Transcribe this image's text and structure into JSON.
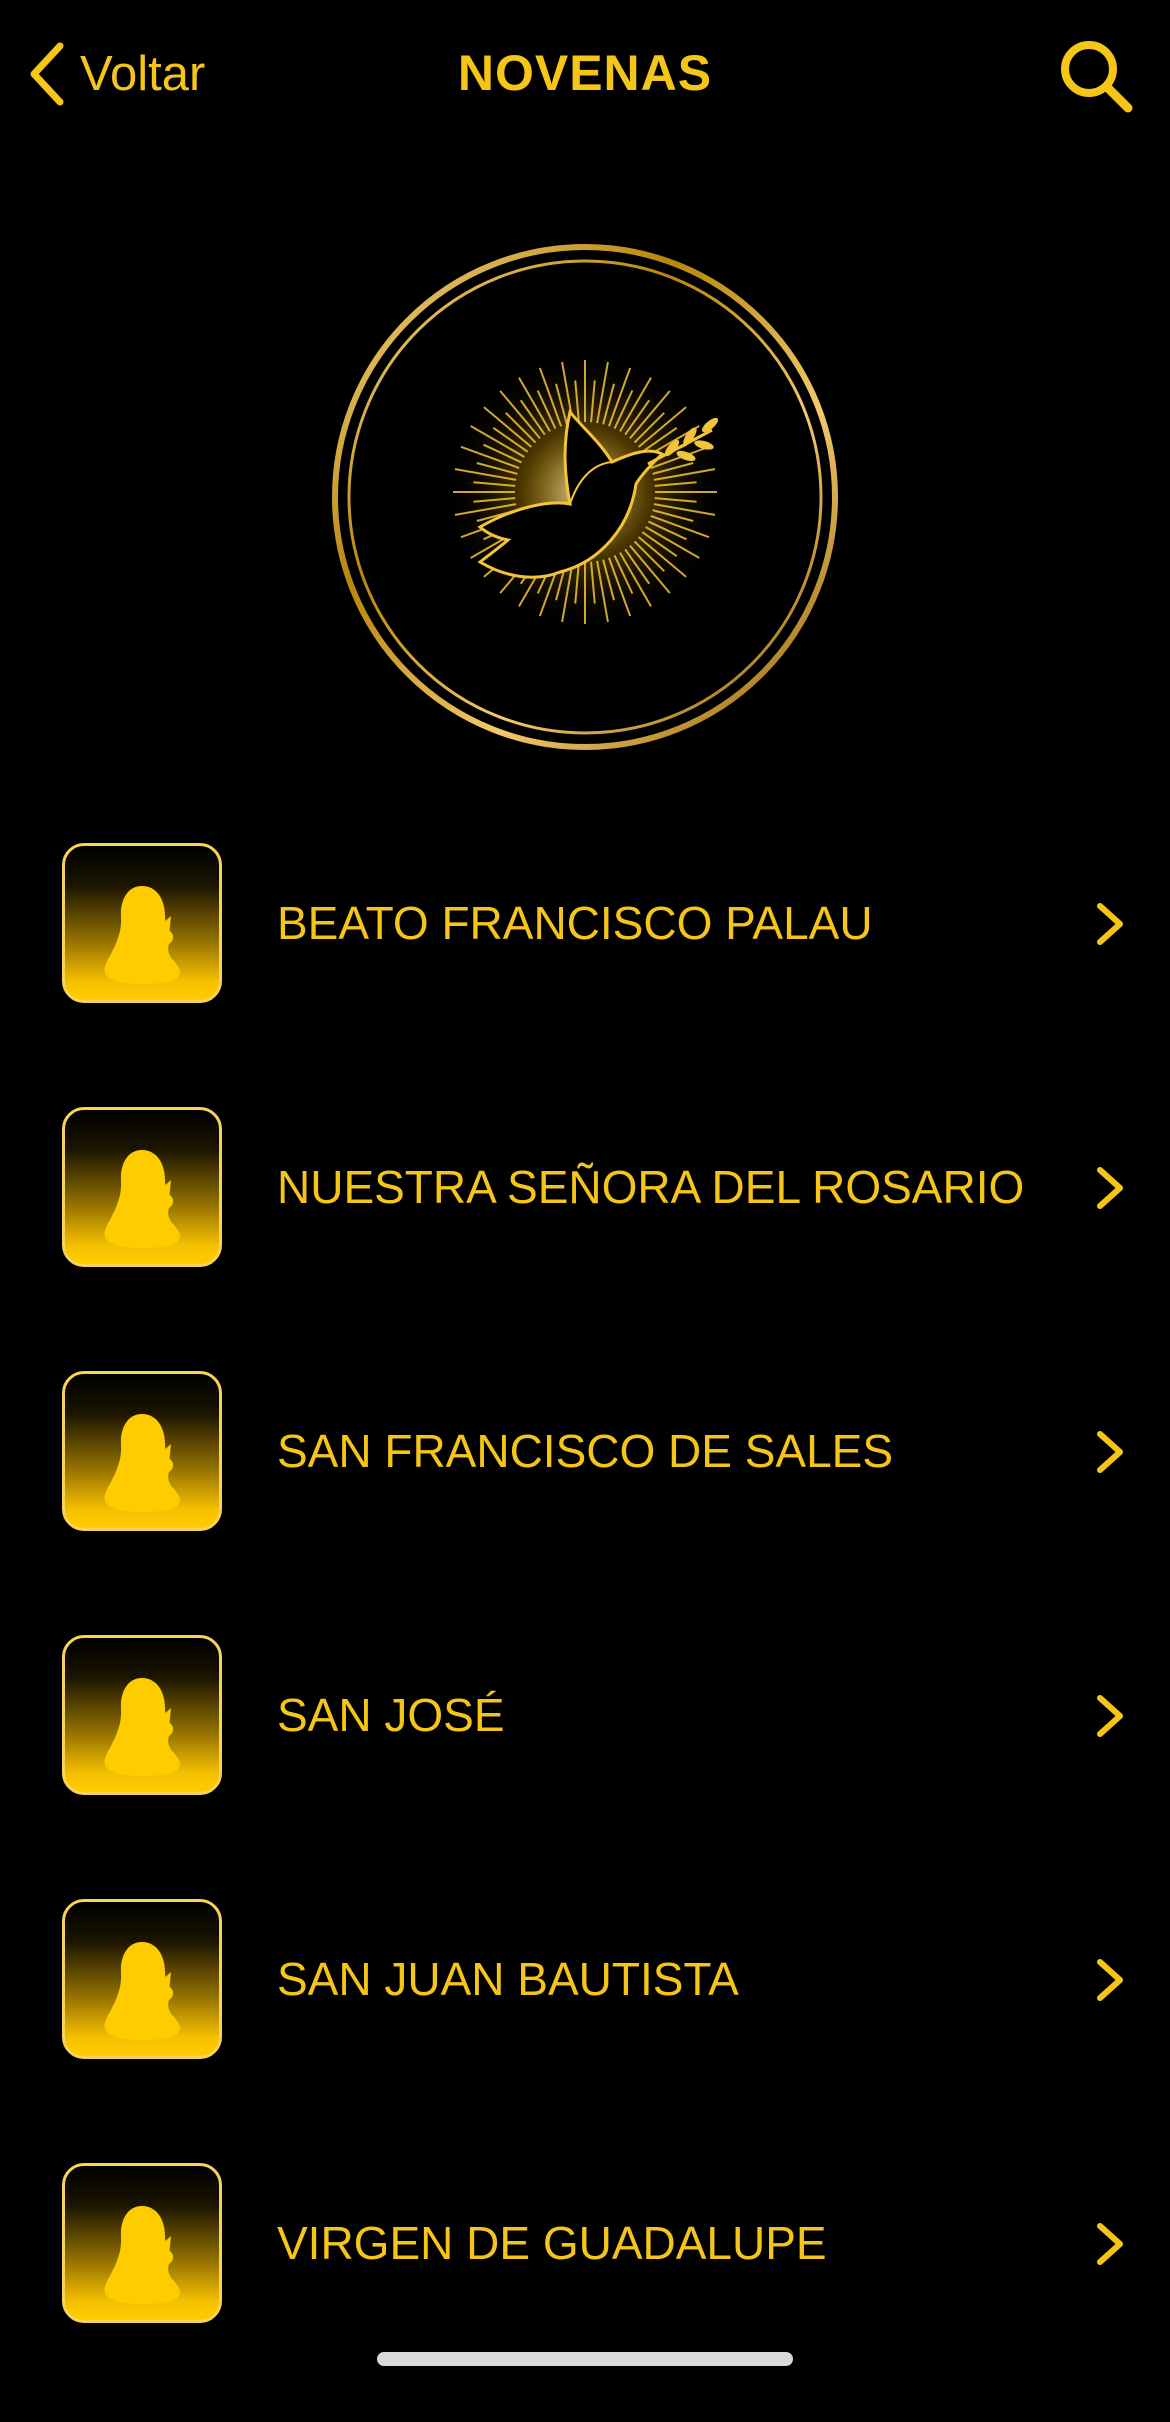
{
  "header": {
    "back_label": "Voltar",
    "title": "NOVENAS"
  },
  "icons": {
    "back": "chevron-left-icon",
    "search": "search-icon",
    "logo": "dove-with-olive-branch-icon",
    "row": "praying-figure-icon",
    "row_chevron": "chevron-right-icon"
  },
  "colors": {
    "accent": "#f5c518",
    "background": "#000000"
  },
  "list": {
    "items": [
      {
        "label": "BEATO FRANCISCO PALAU"
      },
      {
        "label": "NUESTRA SEÑORA DEL ROSARIO"
      },
      {
        "label": "SAN FRANCISCO DE SALES"
      },
      {
        "label": "SAN JOSÉ"
      },
      {
        "label": "SAN JUAN BAUTISTA"
      },
      {
        "label": "VIRGEN DE GUADALUPE"
      }
    ]
  }
}
